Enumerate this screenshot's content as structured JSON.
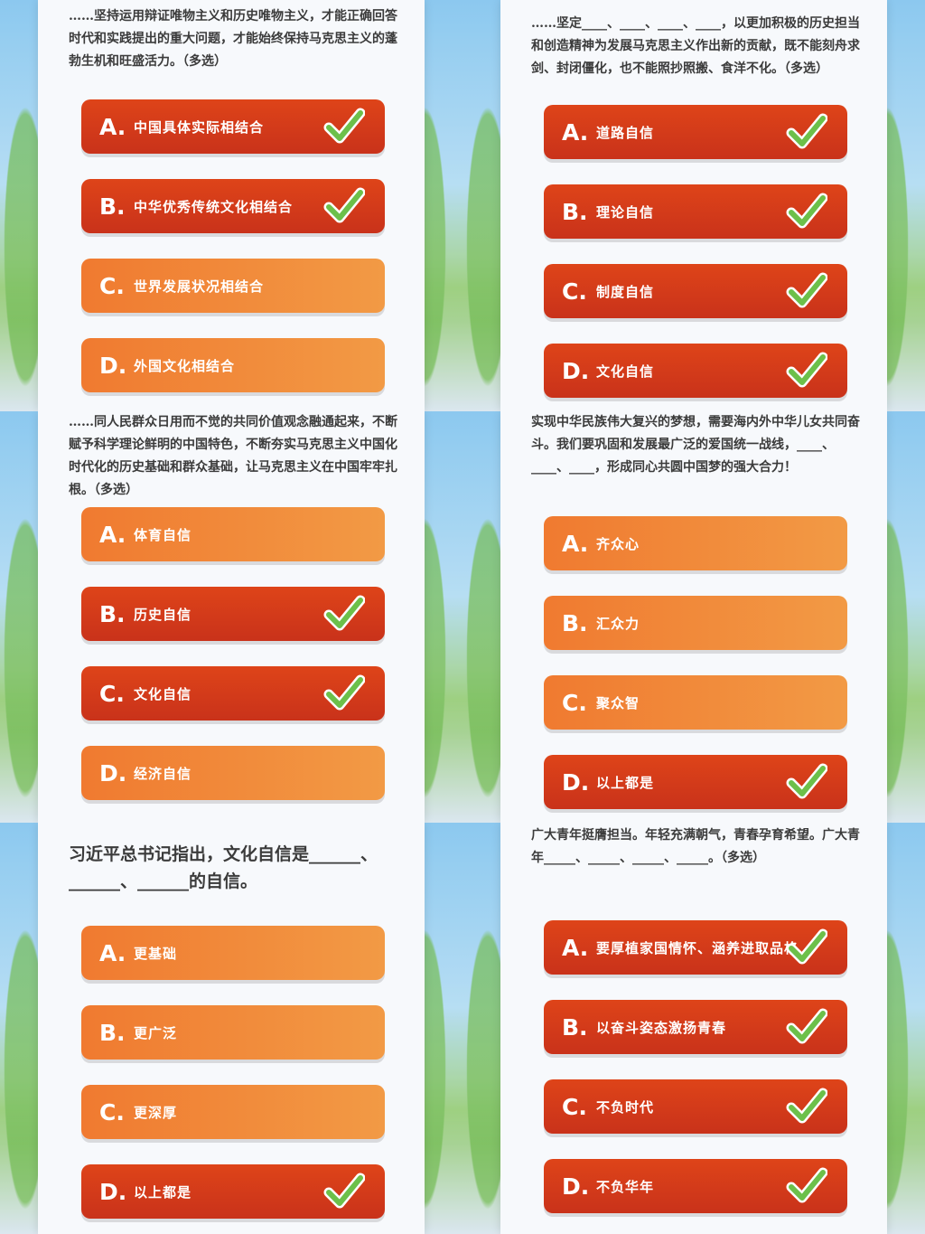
{
  "panels": [
    {
      "question": "……坚持运用辩证唯物主义和历史唯物主义，才能正确回答时代和实践提出的重大问题，才能始终保持马克思主义的蓬勃生机和旺盛活力。（多选）",
      "options": [
        {
          "letter": "A.",
          "label": "中国具体实际相结合",
          "correct": true
        },
        {
          "letter": "B.",
          "label": "中华优秀传统文化相结合",
          "correct": true
        },
        {
          "letter": "C.",
          "label": "世界发展状况相结合",
          "correct": false
        },
        {
          "letter": "D.",
          "label": "外国文化相结合",
          "correct": false
        }
      ]
    },
    {
      "question": "……坚定____、____、____、____，以更加积极的历史担当和创造精神为发展马克思主义作出新的贡献，既不能刻舟求剑、封闭僵化，也不能照抄照搬、食洋不化。（多选）",
      "options": [
        {
          "letter": "A.",
          "label": "道路自信",
          "correct": true
        },
        {
          "letter": "B.",
          "label": "理论自信",
          "correct": true
        },
        {
          "letter": "C.",
          "label": "制度自信",
          "correct": true
        },
        {
          "letter": "D.",
          "label": "文化自信",
          "correct": true
        }
      ]
    },
    {
      "question": "……同人民群众日用而不觉的共同价值观念融通起来，不断赋予科学理论鲜明的中国特色，不断夯实马克思主义中国化时代化的历史基础和群众基础，让马克思主义在中国牢牢扎根。（多选）",
      "options": [
        {
          "letter": "A.",
          "label": "体育自信",
          "correct": false
        },
        {
          "letter": "B.",
          "label": "历史自信",
          "correct": true
        },
        {
          "letter": "C.",
          "label": "文化自信",
          "correct": true
        },
        {
          "letter": "D.",
          "label": "经济自信",
          "correct": false
        }
      ]
    },
    {
      "question": "实现中华民族伟大复兴的梦想，需要海内外中华儿女共同奋斗。我们要巩固和发展最广泛的爱国统一战线，____、____、____，形成同心共圆中国梦的强大合力！",
      "options": [
        {
          "letter": "A.",
          "label": "齐众心",
          "correct": false
        },
        {
          "letter": "B.",
          "label": "汇众力",
          "correct": false
        },
        {
          "letter": "C.",
          "label": "聚众智",
          "correct": false
        },
        {
          "letter": "D.",
          "label": "以上都是",
          "correct": true
        }
      ]
    },
    {
      "question": "习近平总书记指出，文化自信是______、______、______的自信。",
      "options": [
        {
          "letter": "A.",
          "label": "更基础",
          "correct": false
        },
        {
          "letter": "B.",
          "label": "更广泛",
          "correct": false
        },
        {
          "letter": "C.",
          "label": "更深厚",
          "correct": false
        },
        {
          "letter": "D.",
          "label": "以上都是",
          "correct": true
        }
      ]
    },
    {
      "question": "广大青年挺膺担当。年轻充满朝气，青春孕育希望。广大青年_____、_____、_____、_____。（多选）",
      "options": [
        {
          "letter": "A.",
          "label": "要厚植家国情怀、涵养进取品格",
          "correct": true
        },
        {
          "letter": "B.",
          "label": "以奋斗姿态激扬青春",
          "correct": true
        },
        {
          "letter": "C.",
          "label": "不负时代",
          "correct": true
        },
        {
          "letter": "D.",
          "label": "不负华年",
          "correct": true
        }
      ]
    }
  ],
  "colors": {
    "correct_option": "#c9321a",
    "plain_option": "#f08a38",
    "check_mark": "#6cc04a"
  },
  "icons": {
    "check": "check-icon"
  }
}
